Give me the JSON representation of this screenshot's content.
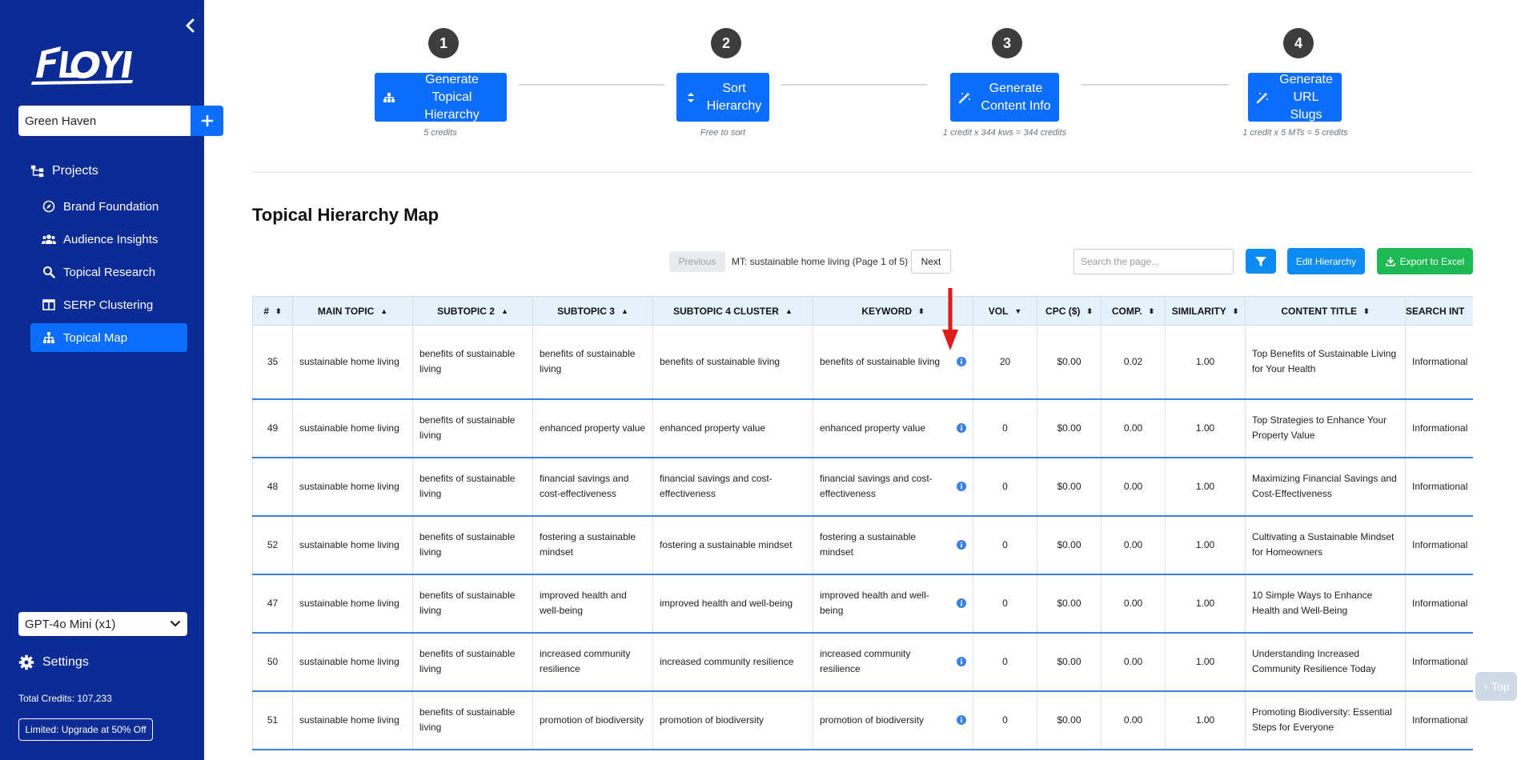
{
  "brand": {
    "logo_text": "FLOYI"
  },
  "sidebar": {
    "project_name": "Green Haven",
    "nav": [
      {
        "label": "Projects",
        "icon": "hierarchy-icon"
      },
      {
        "label": "Brand Foundation",
        "icon": "compass-icon"
      },
      {
        "label": "Audience Insights",
        "icon": "users-icon"
      },
      {
        "label": "Topical Research",
        "icon": "search-icon"
      },
      {
        "label": "SERP Clustering",
        "icon": "columns-icon"
      },
      {
        "label": "Topical Map",
        "icon": "sitemap-icon",
        "active": true
      }
    ],
    "model": "GPT-4o Mini (x1)",
    "settings_label": "Settings",
    "credits": "Total Credits: 107,233",
    "upgrade_label": "Limited: Upgrade at 50% Off"
  },
  "steps": [
    {
      "number": "1",
      "line1": "Generate",
      "line2": "Topical Hierarchy",
      "note": "5 credits"
    },
    {
      "number": "2",
      "line1": "Sort",
      "line2": "Hierarchy",
      "note": "Free to sort"
    },
    {
      "number": "3",
      "line1": "Generate",
      "line2": "Content Info",
      "note": "1 credit x 344 kws = 344 credits"
    },
    {
      "number": "4",
      "line1": "Generate",
      "line2": "URL Slugs",
      "note": "1 credit x 5 MTs = 5 credits"
    }
  ],
  "page_title": "Topical Hierarchy Map",
  "toolbar": {
    "previous": "Previous",
    "page_label": "MT: sustainable home living (Page 1 of 5)",
    "next": "Next",
    "search_placeholder": "Search the page...",
    "edit_hierarchy": "Edit Hierarchy",
    "export": "Export to Excel"
  },
  "table": {
    "headers": [
      "#",
      "MAIN TOPIC",
      "SUBTOPIC 2",
      "SUBTOPIC 3",
      "SUBTOPIC 4 CLUSTER",
      "KEYWORD",
      "VOL",
      "CPC ($)",
      "COMP.",
      "SIMILARITY",
      "CONTENT TITLE",
      "SEARCH INT"
    ],
    "sort_indicators": [
      "⬍",
      "▲",
      "▲",
      "▲",
      "▲",
      "⬍",
      "▼",
      "⬍",
      "⬍",
      "⬍",
      "⬍",
      ""
    ],
    "rows": [
      {
        "num": "35",
        "main": "sustainable home living",
        "sub2": "benefits of sustainable living",
        "sub3": "benefits of sustainable living",
        "sub4": "benefits of sustainable living",
        "keyword": "benefits of sustainable living",
        "vol": "20",
        "cpc": "$0.00",
        "comp": "0.02",
        "sim": "1.00",
        "title": "Top Benefits of Sustainable Living for Your Health",
        "intent": "Informational"
      },
      {
        "num": "49",
        "main": "sustainable home living",
        "sub2": "benefits of sustainable living",
        "sub3": "enhanced property value",
        "sub4": "enhanced property value",
        "keyword": "enhanced property value",
        "vol": "0",
        "cpc": "$0.00",
        "comp": "0.00",
        "sim": "1.00",
        "title": "Top Strategies to Enhance Your Property Value",
        "intent": "Informational"
      },
      {
        "num": "48",
        "main": "sustainable home living",
        "sub2": "benefits of sustainable living",
        "sub3": "financial savings and cost-effectiveness",
        "sub4": "financial savings and cost-effectiveness",
        "keyword": "financial savings and cost-effectiveness",
        "vol": "0",
        "cpc": "$0.00",
        "comp": "0.00",
        "sim": "1.00",
        "title": "Maximizing Financial Savings and Cost-Effectiveness",
        "intent": "Informational"
      },
      {
        "num": "52",
        "main": "sustainable home living",
        "sub2": "benefits of sustainable living",
        "sub3": "fostering a sustainable mindset",
        "sub4": "fostering a sustainable mindset",
        "keyword": "fostering a sustainable mindset",
        "vol": "0",
        "cpc": "$0.00",
        "comp": "0.00",
        "sim": "1.00",
        "title": "Cultivating a Sustainable Mindset for Homeowners",
        "intent": "Informational"
      },
      {
        "num": "47",
        "main": "sustainable home living",
        "sub2": "benefits of sustainable living",
        "sub3": "improved health and well-being",
        "sub4": "improved health and well-being",
        "keyword": "improved health and well-being",
        "vol": "0",
        "cpc": "$0.00",
        "comp": "0.00",
        "sim": "1.00",
        "title": "10 Simple Ways to Enhance Health and Well-Being",
        "intent": "Informational"
      },
      {
        "num": "50",
        "main": "sustainable home living",
        "sub2": "benefits of sustainable living",
        "sub3": "increased community resilience",
        "sub4": "increased community resilience",
        "keyword": "increased community resilience",
        "vol": "0",
        "cpc": "$0.00",
        "comp": "0.00",
        "sim": "1.00",
        "title": "Understanding Increased Community Resilience Today",
        "intent": "Informational"
      },
      {
        "num": "51",
        "main": "sustainable home living",
        "sub2": "benefits of sustainable living",
        "sub3": "promotion of biodiversity",
        "sub4": "promotion of biodiversity",
        "keyword": "promotion of biodiversity",
        "vol": "0",
        "cpc": "$0.00",
        "comp": "0.00",
        "sim": "1.00",
        "title": "Promoting Biodiversity: Essential Steps for Everyone",
        "intent": "Informational"
      }
    ]
  },
  "top_button": "↑ Top",
  "colors": {
    "sidebar": "#0c2b95",
    "primary": "#0d6efd",
    "filter": "#0d8bf2",
    "export": "#1db954",
    "row_border": "#3a82e0",
    "arrow": "#e01b1b"
  }
}
